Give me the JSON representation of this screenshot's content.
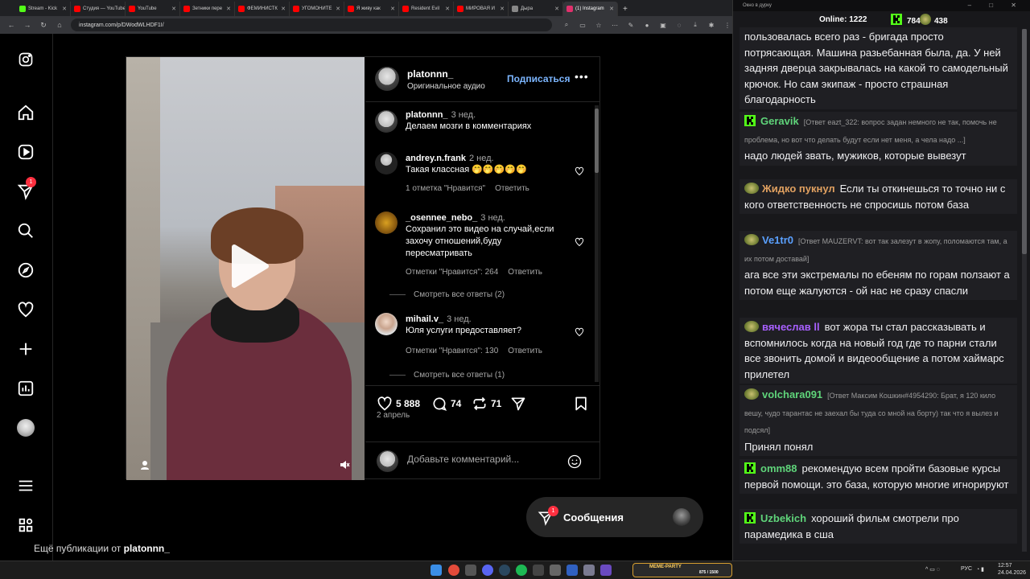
{
  "browser": {
    "tabs": [
      {
        "label": "Stream - Kick",
        "color": "#53fc18"
      },
      {
        "label": "Студия — YouTube",
        "color": "#ff0000"
      },
      {
        "label": "YouTube",
        "color": "#ff0000"
      },
      {
        "label": "Зетники пере",
        "color": "#ff0000"
      },
      {
        "label": "ФЕМИНИСТК",
        "color": "#ff0000"
      },
      {
        "label": "УГОМОНИТЕ",
        "color": "#ff0000"
      },
      {
        "label": "Я живу как",
        "color": "#ff0000"
      },
      {
        "label": "Resident Evil",
        "color": "#ff0000"
      },
      {
        "label": "МИРОВАЯ И",
        "color": "#ff0000"
      },
      {
        "label": "Дыра",
        "color": "#888888"
      },
      {
        "label": "(1) Instagram",
        "color": "#e1306c",
        "active": true
      }
    ],
    "url": "instagram.com/p/DWodWLHDF1I/"
  },
  "instagram": {
    "nav_badge": "1",
    "post": {
      "username": "platonnn_",
      "audio": "Оригинальное аудио",
      "follow": "Подписаться",
      "likes": "5 888",
      "comments_count": "74",
      "reposts": "71",
      "date": "2 апрель",
      "add_comment_placeholder": "Добавьте комментарий..."
    },
    "comments": [
      {
        "user": "platonnn_",
        "time": "3 нед.",
        "text": "Делаем мозги в комментариях"
      },
      {
        "user": "andrey.n.frank",
        "time": "2 нед.",
        "text": "Такая классная 🤭🤭🤭🤭🤭",
        "likes": "1 отметка \"Нравится\"",
        "reply": "Ответить"
      },
      {
        "user": "_osennee_nebo_",
        "time": "3 нед.",
        "text": "Сохранил это видео на случай,если захочу отношений,буду пересматривать",
        "likes": "Отметки \"Нравится\": 264",
        "reply": "Ответить",
        "view_replies": "Смотреть все ответы (2)"
      },
      {
        "user": "mihail.v_",
        "time": "3 нед.",
        "text": "Юля услуги предоставляет?",
        "likes": "Отметки \"Нравится\": 130",
        "reply": "Ответить",
        "view_replies": "Смотреть все ответы (1)"
      }
    ],
    "messages": {
      "label": "Сообщения",
      "badge": "1"
    },
    "more_from": {
      "prefix": "Ещё публикации от",
      "user": "platonnn_"
    }
  },
  "chat": {
    "window_title": "Окно в дурку",
    "online_label": "Online:",
    "online": "1222",
    "kick_count": "784",
    "other_count": "438",
    "messages": [
      {
        "text": "пользовалась всего раз - бригада просто потрясающая. Машина разьебанная была, да. У ней задняя дверца закрывалась на какой то самодельный крючок. Но сам экипаж - просто страшная благодарность"
      },
      {
        "platform": "kick",
        "user": "Geravik",
        "user_color": "#5fd47a",
        "reply": "[Ответ eazt_322: вопрос задан немного не так, помочь не проблема, но вот что делать будут если нет меня, а чела надо ...]",
        "text": "надо людей звать, мужиков, которые вывезут"
      },
      {
        "platform": "other",
        "user": "Жидко пукнул",
        "user_color": "#e0a060",
        "text": "Если ты откинешься то точно ни с кого ответственность не спросишь потом база"
      },
      {
        "platform": "other",
        "user": "Ve1tr0",
        "user_color": "#5aa0ff",
        "reply": "[Ответ MAUZERVT: вот так залезут в жопу, поломаются там, а их потом доставай]",
        "text": "ага все эти экстремалы по ебеням по горам ползают а потом еще жалуются - ой нас не сразу спасли"
      },
      {
        "platform": "other",
        "user": "вячеслав ll",
        "user_color": "#a860ff",
        "text": "вот жора ты стал рассказывать и вспомнилось когда на новый год где то парни стали все звонить домой и видеообщение а потом хаймарс прилетел"
      },
      {
        "platform": "other",
        "user": "volchara091",
        "user_color": "#5fd47a",
        "reply": "[Ответ Максим Кошкин#4954290: Брат, я 120 кило вешу, чудо тарантас не заехал бы туда со мной на борту) так что я вылез и подсял]",
        "text": "Принял понял"
      },
      {
        "platform": "kick",
        "user": "omm88",
        "user_color": "#5fd47a",
        "text": "рекомендую всем пройти базовые курсы первой помощи. это база, которую многие игнорируют"
      },
      {
        "platform": "kick",
        "user": "Uzbekich",
        "user_color": "#5fd47a",
        "text": "хороший фильм смотрели про парамедика в сша"
      }
    ]
  },
  "taskbar": {
    "widget": "МЕМЕ-PARTY",
    "widget_count": "875 / 1500",
    "lang": "РУС",
    "time": "12:57",
    "date": "24.04.2026"
  }
}
